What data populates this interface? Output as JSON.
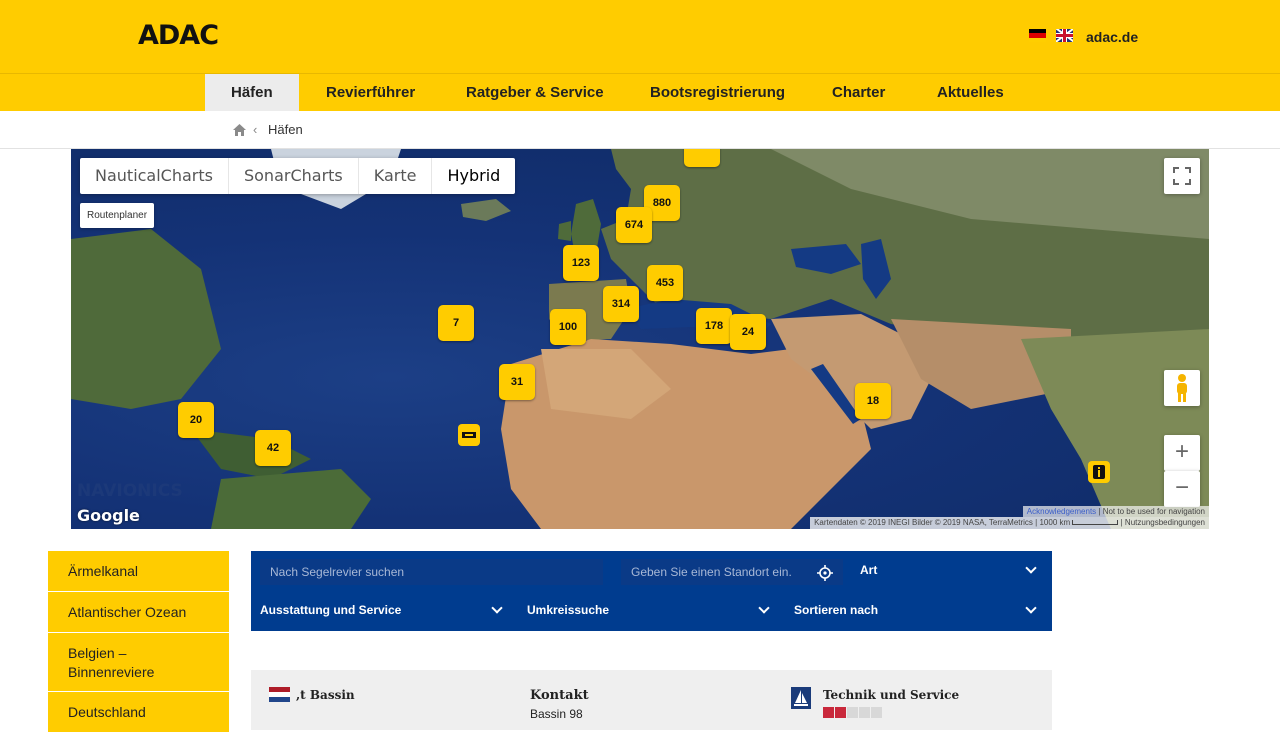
{
  "header": {
    "logo": "ADAC",
    "site": "adac.de",
    "languages": [
      "de-flag-icon",
      "uk-flag-icon"
    ]
  },
  "nav": {
    "items": [
      "Häfen",
      "Revierführer",
      "Ratgeber & Service",
      "Bootsregistrierung",
      "Charter",
      "Aktuelles"
    ],
    "active": "Häfen"
  },
  "breadcrumb": {
    "current": "Häfen"
  },
  "map": {
    "types": [
      "NauticalCharts",
      "SonarCharts",
      "Karte",
      "Hybrid"
    ],
    "active_type": "Hybrid",
    "route_planner": "Routenplaner",
    "clusters": [
      "880",
      "674",
      "123",
      "453",
      "314",
      "100",
      "7",
      "178",
      "24",
      "31",
      "18",
      "20",
      "42"
    ],
    "google": "Google",
    "navionics": "NAVIONICS",
    "acknowledgements": "Acknowledgements",
    "not_for_nav": "Not to be used for navigation",
    "attribution": "Kartendaten © 2019 INEGI Bilder © 2019 NASA, TerraMetrics",
    "scale": "1000 km",
    "terms": "Nutzungsbedingungen"
  },
  "sidebar": {
    "items": [
      "Ärmelkanal",
      "Atlantischer Ozean",
      "Belgien – Binnenreviere",
      "Deutschland"
    ]
  },
  "filter": {
    "revier_placeholder": "Nach Segelrevier suchen",
    "location_placeholder": "Geben Sie einen Standort ein.",
    "art": "Art",
    "ausstattung": "Ausstattung und Service",
    "umkreis": "Umkreissuche",
    "sortieren": "Sortieren nach"
  },
  "result": {
    "name": ",t Bassin",
    "kontakt_label": "Kontakt",
    "address": "Bassin 98",
    "technik_label": "Technik und Service"
  },
  "colors": {
    "brand_yellow": "#ffcc00",
    "filter_blue": "#003c8f"
  }
}
